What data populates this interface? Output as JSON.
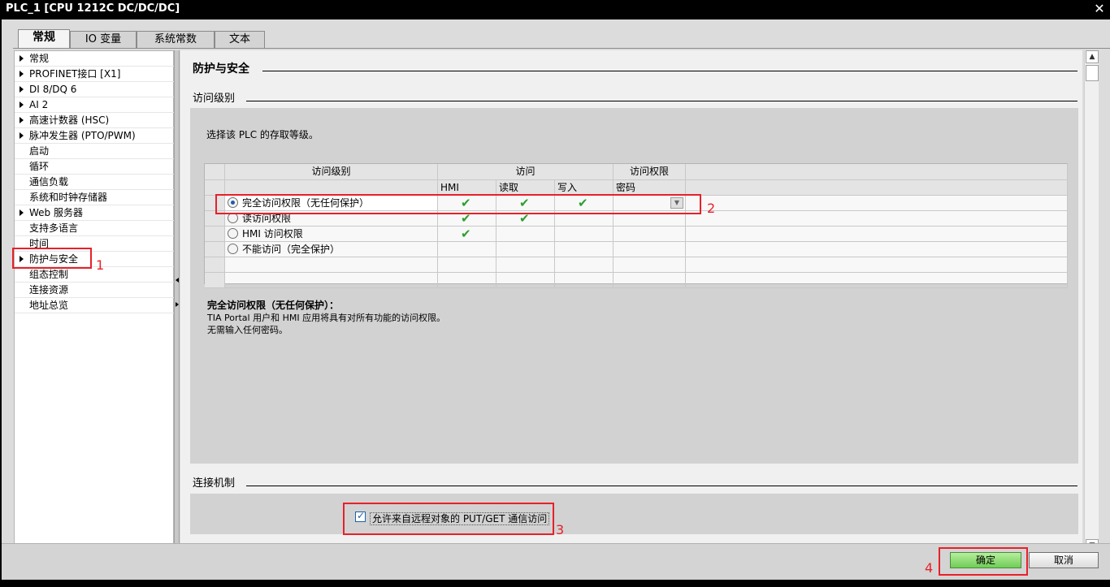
{
  "window": {
    "title": "PLC_1 [CPU 1212C DC/DC/DC]",
    "close_glyph": "✕"
  },
  "tabs": [
    {
      "label": "常规"
    },
    {
      "label": "IO 变量"
    },
    {
      "label": "系统常数"
    },
    {
      "label": "文本"
    }
  ],
  "nav": [
    {
      "label": "常规",
      "arrow": true
    },
    {
      "label": "PROFINET接口 [X1]",
      "arrow": true
    },
    {
      "label": "DI 8/DQ 6",
      "arrow": true
    },
    {
      "label": "AI 2",
      "arrow": true
    },
    {
      "label": "高速计数器 (HSC)",
      "arrow": true
    },
    {
      "label": "脉冲发生器 (PTO/PWM)",
      "arrow": true
    },
    {
      "label": "启动",
      "arrow": false
    },
    {
      "label": "循环",
      "arrow": false
    },
    {
      "label": "通信负载",
      "arrow": false
    },
    {
      "label": "系统和时钟存储器",
      "arrow": false
    },
    {
      "label": "Web 服务器",
      "arrow": true
    },
    {
      "label": "支持多语言",
      "arrow": false
    },
    {
      "label": "时间",
      "arrow": false
    },
    {
      "label": "防护与安全",
      "arrow": true
    },
    {
      "label": "组态控制",
      "arrow": false
    },
    {
      "label": "连接资源",
      "arrow": false
    },
    {
      "label": "地址总览",
      "arrow": false
    }
  ],
  "content": {
    "section_title": "防护与安全",
    "access_level_heading": "访问级别",
    "intro": "选择该 PLC 的存取等级。",
    "table": {
      "group_headers": {
        "level": "访问级别",
        "access": "访问",
        "permission": "访问权限"
      },
      "sub_headers": {
        "hmi": "HMI",
        "read": "读取",
        "write": "写入",
        "password": "密码"
      },
      "rows": [
        {
          "label": "完全访问权限（无任何保护）",
          "selected": true,
          "hmi": true,
          "read": true,
          "write": true
        },
        {
          "label": "读访问权限",
          "selected": false,
          "hmi": true,
          "read": true,
          "write": false
        },
        {
          "label": "HMI 访问权限",
          "selected": false,
          "hmi": true,
          "read": false,
          "write": false
        },
        {
          "label": "不能访问（完全保护）",
          "selected": false,
          "hmi": false,
          "read": false,
          "write": false
        }
      ],
      "check_glyph": "✔",
      "dropdown_glyph": "▼"
    },
    "desc_title": "完全访问权限（无任何保护）：",
    "desc_line1": "TIA Portal 用户和 HMI 应用将具有对所有功能的访问权限。",
    "desc_line2": "无需输入任何密码。",
    "connection_heading": "连接机制",
    "putget_label": "允许来自远程对象的 PUT/GET 通信访问",
    "putget_checked": true
  },
  "annotations": {
    "a1": "1",
    "a2": "2",
    "a3": "3",
    "a4": "4"
  },
  "footer": {
    "ok": "确定",
    "cancel": "取消"
  },
  "scroll": {
    "up": "▲",
    "down": "▼"
  },
  "colors": {
    "annotation": "#e8202a",
    "check": "#2e9e2e",
    "ok_button": "#6fcd55"
  }
}
